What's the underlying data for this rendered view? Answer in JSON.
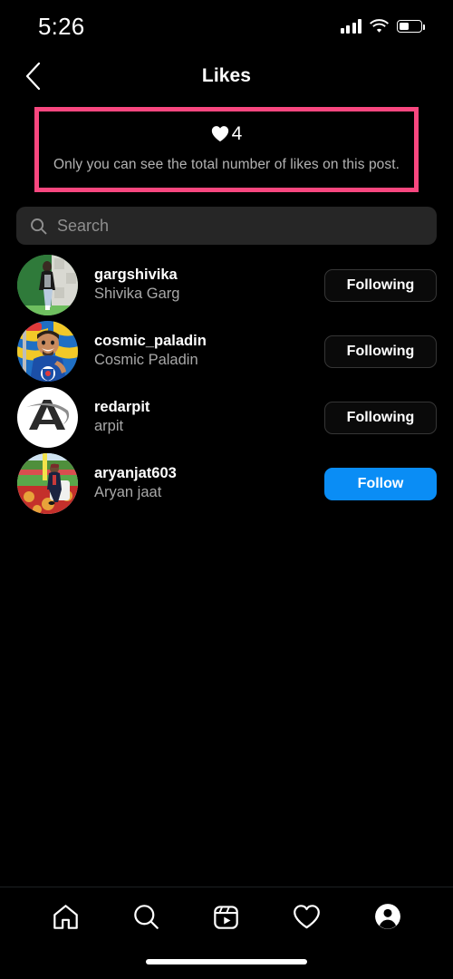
{
  "status_bar": {
    "time": "5:26",
    "signal_icon": "cellular-signal-icon",
    "wifi_icon": "wifi-icon",
    "battery_icon": "battery-icon",
    "battery_level_percent": 45
  },
  "header": {
    "back_icon": "back-chevron-icon",
    "title": "Likes"
  },
  "highlight_box": {
    "border_color": "#f9477f",
    "heart_icon": "heart-filled-icon",
    "like_count": "4",
    "privacy_note": "Only you can see the total number of likes on this post."
  },
  "search": {
    "icon": "search-icon",
    "placeholder": "Search",
    "value": ""
  },
  "users": [
    {
      "username": "gargshivika",
      "full_name": "Shivika Garg",
      "action_label": "Following",
      "action_state": "following",
      "avatar_name": "avatar-gargshivika"
    },
    {
      "username": "cosmic_paladin",
      "full_name": "Cosmic Paladin",
      "action_label": "Following",
      "action_state": "following",
      "avatar_name": "avatar-cosmic-paladin"
    },
    {
      "username": "redarpit",
      "full_name": "arpit",
      "action_label": "Following",
      "action_state": "following",
      "avatar_name": "avatar-redarpit"
    },
    {
      "username": "aryanjat603",
      "full_name": "Aryan jaat",
      "action_label": "Follow",
      "action_state": "follow",
      "avatar_name": "avatar-aryanjat603"
    }
  ],
  "tab_bar": {
    "items": [
      {
        "name": "home-icon",
        "label": "Home"
      },
      {
        "name": "search-icon",
        "label": "Search"
      },
      {
        "name": "reels-icon",
        "label": "Reels"
      },
      {
        "name": "heart-outline-icon",
        "label": "Activity"
      },
      {
        "name": "profile-avatar-icon",
        "label": "Profile"
      }
    ]
  },
  "colors": {
    "accent_blue": "#0a8df5",
    "highlight_pink": "#f9477f",
    "background": "#000000",
    "search_field": "#262626",
    "secondary_text": "#a8a8a8"
  }
}
